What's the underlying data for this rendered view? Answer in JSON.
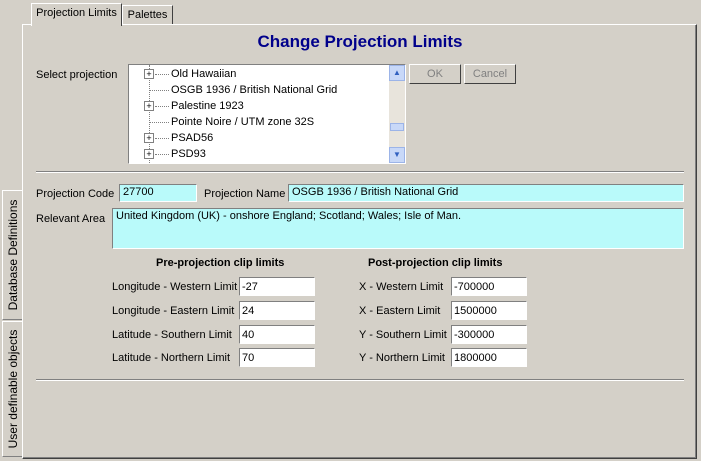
{
  "tabs": {
    "projection_limits": "Projection Limits",
    "palettes": "Palettes"
  },
  "side_tabs": {
    "database_definitions": "Database Definitions",
    "user_definable_objects": "User definable objects"
  },
  "title": "Change Projection Limits",
  "select_projection_label": "Select projection",
  "projection_list": [
    {
      "label": "Old Hawaiian",
      "expandable": true
    },
    {
      "label": "OSGB 1936 / British National Grid",
      "expandable": false
    },
    {
      "label": "Palestine 1923",
      "expandable": true
    },
    {
      "label": "Pointe Noire / UTM zone 32S",
      "expandable": false
    },
    {
      "label": "PSAD56",
      "expandable": true
    },
    {
      "label": "PSD93",
      "expandable": true
    }
  ],
  "buttons": {
    "ok": "OK",
    "cancel": "Cancel"
  },
  "projection_code_label": "Projection Code",
  "projection_code": "27700",
  "projection_name_label": "Projection Name",
  "projection_name": "OSGB 1936 / British National Grid",
  "relevant_area_label": "Relevant Area",
  "relevant_area": "United Kingdom (UK) - onshore England; Scotland; Wales; Isle of Man.",
  "pre": {
    "heading": "Pre-projection clip limits",
    "lon_west_label": "Longitude - Western Limit",
    "lon_west": "-27",
    "lon_east_label": "Longitude - Eastern Limit",
    "lon_east": "24",
    "lat_south_label": "Latitude - Southern Limit",
    "lat_south": "40",
    "lat_north_label": "Latitude - Northern Limit",
    "lat_north": "70"
  },
  "post": {
    "heading": "Post-projection clip limits",
    "x_west_label": "X - Western Limit",
    "x_west": "-700000",
    "x_east_label": "X - Eastern Limit",
    "x_east": "1500000",
    "y_south_label": "Y - Southern Limit",
    "y_south": "-300000",
    "y_north_label": "Y - Northern Limit",
    "y_north": "1800000"
  }
}
